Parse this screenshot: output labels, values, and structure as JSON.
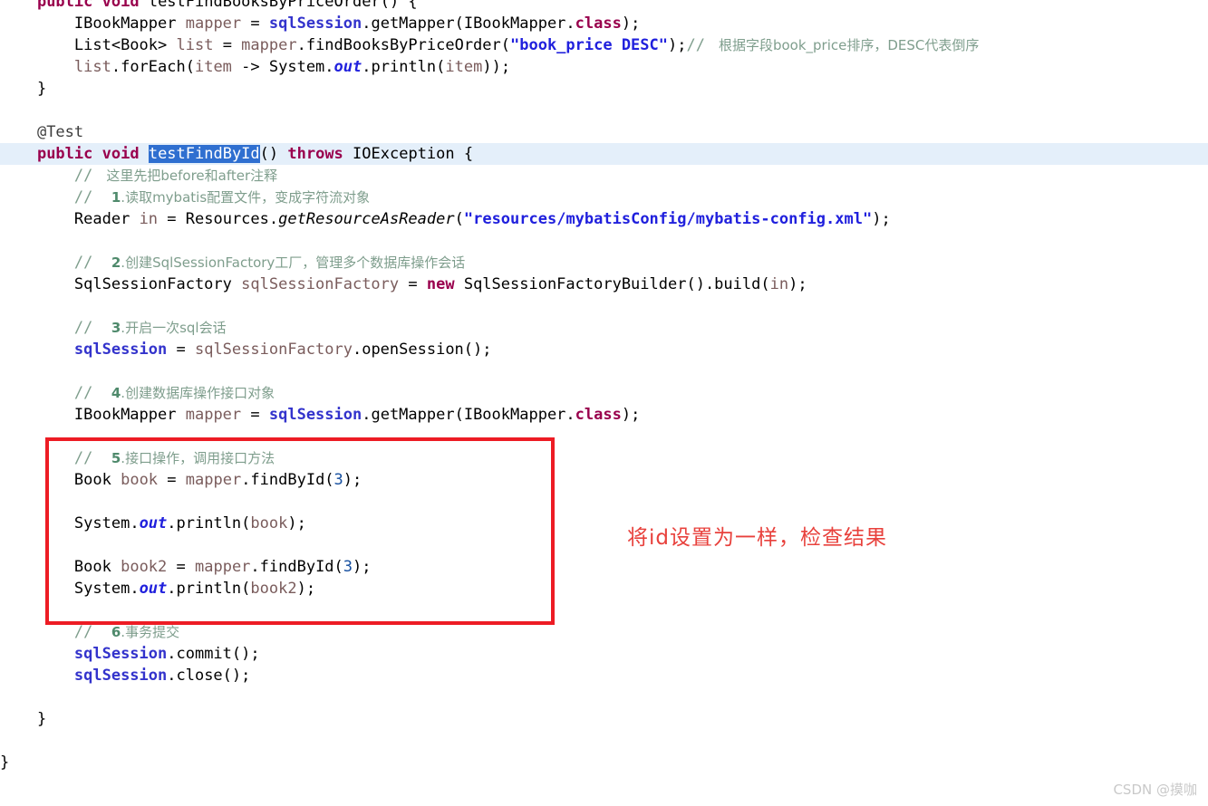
{
  "editor": {
    "language": "Java",
    "background_color": "#ffffff",
    "caret_line_color": "#e4effa",
    "selection_color": "#2f6fd0",
    "annotation_box_color": "#ed1c24",
    "annotation_text_color": "#e8413c"
  },
  "annotation": {
    "note_text": "将id设置为一样，检查结果",
    "box_label": "red-highlight-box"
  },
  "watermark": {
    "text": "CSDN @摸咖"
  },
  "code": {
    "lines": [
      {
        "id": "line-1",
        "tokens": [
          {
            "t": "    ",
            "c": "plain"
          },
          {
            "t": "public",
            "c": "kw"
          },
          {
            "t": " ",
            "c": "plain"
          },
          {
            "t": "void",
            "c": "kw"
          },
          {
            "t": " ",
            "c": "plain"
          },
          {
            "t": "testFindBooksByPriceOrder",
            "c": "meth"
          },
          {
            "t": "() {",
            "c": "plain"
          }
        ]
      },
      {
        "id": "line-2",
        "tokens": [
          {
            "t": "        ",
            "c": "plain"
          },
          {
            "t": "IBookMapper",
            "c": "type"
          },
          {
            "t": " ",
            "c": "plain"
          },
          {
            "t": "mapper",
            "c": "local"
          },
          {
            "t": " = ",
            "c": "plain"
          },
          {
            "t": "sqlSession",
            "c": "field"
          },
          {
            "t": ".getMapper(",
            "c": "plain"
          },
          {
            "t": "IBookMapper",
            "c": "type"
          },
          {
            "t": ".",
            "c": "plain"
          },
          {
            "t": "class",
            "c": "kw"
          },
          {
            "t": ");",
            "c": "plain"
          }
        ]
      },
      {
        "id": "line-3",
        "tokens": [
          {
            "t": "        ",
            "c": "plain"
          },
          {
            "t": "List<Book>",
            "c": "type"
          },
          {
            "t": " ",
            "c": "plain"
          },
          {
            "t": "list",
            "c": "local"
          },
          {
            "t": " = ",
            "c": "plain"
          },
          {
            "t": "mapper",
            "c": "local"
          },
          {
            "t": ".findBooksByPriceOrder(",
            "c": "plain"
          },
          {
            "t": "\"book_price DESC\"",
            "c": "str"
          },
          {
            "t": ");",
            "c": "plain"
          },
          {
            "t": "// ",
            "c": "cmt"
          },
          {
            "t": " 根据字段book_price排序，DESC代表倒序",
            "c": "cmt cjk"
          }
        ]
      },
      {
        "id": "line-4",
        "tokens": [
          {
            "t": "        ",
            "c": "plain"
          },
          {
            "t": "list",
            "c": "local"
          },
          {
            "t": ".forEach(",
            "c": "plain"
          },
          {
            "t": "item",
            "c": "local"
          },
          {
            "t": " -> ",
            "c": "plain"
          },
          {
            "t": "System",
            "c": "plain"
          },
          {
            "t": ".",
            "c": "plain"
          },
          {
            "t": "out",
            "c": "outfld"
          },
          {
            "t": ".println(",
            "c": "plain"
          },
          {
            "t": "item",
            "c": "local"
          },
          {
            "t": "));",
            "c": "plain"
          }
        ]
      },
      {
        "id": "line-5",
        "tokens": [
          {
            "t": "    }",
            "c": "plain"
          }
        ]
      },
      {
        "id": "line-6",
        "tokens": [
          {
            "t": "",
            "c": "plain"
          }
        ]
      },
      {
        "id": "line-7",
        "tokens": [
          {
            "t": "    ",
            "c": "plain"
          },
          {
            "t": "@Test",
            "c": "anno"
          }
        ]
      },
      {
        "id": "line-8",
        "caret": true,
        "tokens": [
          {
            "t": "    ",
            "c": "plain"
          },
          {
            "t": "public",
            "c": "kw"
          },
          {
            "t": " ",
            "c": "plain"
          },
          {
            "t": "void",
            "c": "kw"
          },
          {
            "t": " ",
            "c": "plain"
          },
          {
            "t": "testFindById",
            "c": "sel"
          },
          {
            "t": "() ",
            "c": "plain"
          },
          {
            "t": "throws",
            "c": "kw"
          },
          {
            "t": " ",
            "c": "plain"
          },
          {
            "t": "IOException",
            "c": "type"
          },
          {
            "t": " {",
            "c": "plain"
          }
        ]
      },
      {
        "id": "line-9",
        "tokens": [
          {
            "t": "        ",
            "c": "plain"
          },
          {
            "t": "// ",
            "c": "cmt"
          },
          {
            "t": " 这里先把before和after注释",
            "c": "cmt cjk"
          }
        ]
      },
      {
        "id": "line-10",
        "tokens": [
          {
            "t": "        ",
            "c": "plain"
          },
          {
            "t": "// ",
            "c": "cmt"
          },
          {
            "t": " ",
            "c": "cmt"
          },
          {
            "t": "1",
            "c": "cmt-num cjk"
          },
          {
            "t": ".读取mybatis配置文件，变成字符流对象",
            "c": "cmt cjk"
          }
        ]
      },
      {
        "id": "line-11",
        "tokens": [
          {
            "t": "        ",
            "c": "plain"
          },
          {
            "t": "Reader",
            "c": "type"
          },
          {
            "t": " ",
            "c": "plain"
          },
          {
            "t": "in",
            "c": "local"
          },
          {
            "t": " = ",
            "c": "plain"
          },
          {
            "t": "Resources",
            "c": "plain"
          },
          {
            "t": ".",
            "c": "plain"
          },
          {
            "t": "getResourceAsReader",
            "c": "methit"
          },
          {
            "t": "(",
            "c": "plain"
          },
          {
            "t": "\"resources/mybatisConfig/mybatis-config.xml\"",
            "c": "str"
          },
          {
            "t": ");",
            "c": "plain"
          }
        ]
      },
      {
        "id": "line-12",
        "tokens": [
          {
            "t": "",
            "c": "plain"
          }
        ]
      },
      {
        "id": "line-13",
        "tokens": [
          {
            "t": "        ",
            "c": "plain"
          },
          {
            "t": "// ",
            "c": "cmt"
          },
          {
            "t": " ",
            "c": "cmt"
          },
          {
            "t": "2",
            "c": "cmt-num cjk"
          },
          {
            "t": ".创建SqlSessionFactory工厂，管理多个数据库操作会话",
            "c": "cmt cjk"
          }
        ]
      },
      {
        "id": "line-14",
        "tokens": [
          {
            "t": "        ",
            "c": "plain"
          },
          {
            "t": "SqlSessionFactory",
            "c": "type"
          },
          {
            "t": " ",
            "c": "plain"
          },
          {
            "t": "sqlSessionFactory",
            "c": "local"
          },
          {
            "t": " = ",
            "c": "plain"
          },
          {
            "t": "new",
            "c": "kw"
          },
          {
            "t": " ",
            "c": "plain"
          },
          {
            "t": "SqlSessionFactoryBuilder",
            "c": "plain"
          },
          {
            "t": "().build(",
            "c": "plain"
          },
          {
            "t": "in",
            "c": "local"
          },
          {
            "t": ");",
            "c": "plain"
          }
        ]
      },
      {
        "id": "line-15",
        "tokens": [
          {
            "t": "",
            "c": "plain"
          }
        ]
      },
      {
        "id": "line-16",
        "tokens": [
          {
            "t": "        ",
            "c": "plain"
          },
          {
            "t": "// ",
            "c": "cmt"
          },
          {
            "t": " ",
            "c": "cmt"
          },
          {
            "t": "3",
            "c": "cmt-num cjk"
          },
          {
            "t": ".开启一次sql会话",
            "c": "cmt cjk"
          }
        ]
      },
      {
        "id": "line-17",
        "tokens": [
          {
            "t": "        ",
            "c": "plain"
          },
          {
            "t": "sqlSession",
            "c": "field"
          },
          {
            "t": " = ",
            "c": "plain"
          },
          {
            "t": "sqlSessionFactory",
            "c": "local"
          },
          {
            "t": ".openSession();",
            "c": "plain"
          }
        ]
      },
      {
        "id": "line-18",
        "tokens": [
          {
            "t": "",
            "c": "plain"
          }
        ]
      },
      {
        "id": "line-19",
        "tokens": [
          {
            "t": "        ",
            "c": "plain"
          },
          {
            "t": "// ",
            "c": "cmt"
          },
          {
            "t": " ",
            "c": "cmt"
          },
          {
            "t": "4",
            "c": "cmt-num cjk"
          },
          {
            "t": ".创建数据库操作接口对象",
            "c": "cmt cjk"
          }
        ]
      },
      {
        "id": "line-20",
        "tokens": [
          {
            "t": "        ",
            "c": "plain"
          },
          {
            "t": "IBookMapper",
            "c": "type"
          },
          {
            "t": " ",
            "c": "plain"
          },
          {
            "t": "mapper",
            "c": "local"
          },
          {
            "t": " = ",
            "c": "plain"
          },
          {
            "t": "sqlSession",
            "c": "field"
          },
          {
            "t": ".getMapper(",
            "c": "plain"
          },
          {
            "t": "IBookMapper",
            "c": "type"
          },
          {
            "t": ".",
            "c": "plain"
          },
          {
            "t": "class",
            "c": "kw"
          },
          {
            "t": ");",
            "c": "plain"
          }
        ]
      },
      {
        "id": "line-21",
        "tokens": [
          {
            "t": "",
            "c": "plain"
          }
        ]
      },
      {
        "id": "line-22",
        "tokens": [
          {
            "t": "        ",
            "c": "plain"
          },
          {
            "t": "// ",
            "c": "cmt"
          },
          {
            "t": " ",
            "c": "cmt"
          },
          {
            "t": "5",
            "c": "cmt-num cjk"
          },
          {
            "t": ".接口操作，调用接口方法",
            "c": "cmt cjk"
          }
        ]
      },
      {
        "id": "line-23",
        "tokens": [
          {
            "t": "        ",
            "c": "plain"
          },
          {
            "t": "Book",
            "c": "type"
          },
          {
            "t": " ",
            "c": "plain"
          },
          {
            "t": "book",
            "c": "local"
          },
          {
            "t": " = ",
            "c": "plain"
          },
          {
            "t": "mapper",
            "c": "local"
          },
          {
            "t": ".findById(",
            "c": "plain"
          },
          {
            "t": "3",
            "c": "num"
          },
          {
            "t": ");",
            "c": "plain"
          }
        ]
      },
      {
        "id": "line-24",
        "tokens": [
          {
            "t": "",
            "c": "plain"
          }
        ]
      },
      {
        "id": "line-25",
        "tokens": [
          {
            "t": "        ",
            "c": "plain"
          },
          {
            "t": "System",
            "c": "plain"
          },
          {
            "t": ".",
            "c": "plain"
          },
          {
            "t": "out",
            "c": "outfld"
          },
          {
            "t": ".println(",
            "c": "plain"
          },
          {
            "t": "book",
            "c": "local"
          },
          {
            "t": ");",
            "c": "plain"
          }
        ]
      },
      {
        "id": "line-26",
        "tokens": [
          {
            "t": "",
            "c": "plain"
          }
        ]
      },
      {
        "id": "line-27",
        "tokens": [
          {
            "t": "        ",
            "c": "plain"
          },
          {
            "t": "Book",
            "c": "type"
          },
          {
            "t": " ",
            "c": "plain"
          },
          {
            "t": "book2",
            "c": "local"
          },
          {
            "t": " = ",
            "c": "plain"
          },
          {
            "t": "mapper",
            "c": "local"
          },
          {
            "t": ".findById(",
            "c": "plain"
          },
          {
            "t": "3",
            "c": "num"
          },
          {
            "t": ");",
            "c": "plain"
          }
        ]
      },
      {
        "id": "line-28",
        "tokens": [
          {
            "t": "        ",
            "c": "plain"
          },
          {
            "t": "System",
            "c": "plain"
          },
          {
            "t": ".",
            "c": "plain"
          },
          {
            "t": "out",
            "c": "outfld"
          },
          {
            "t": ".println(",
            "c": "plain"
          },
          {
            "t": "book2",
            "c": "local"
          },
          {
            "t": ");",
            "c": "plain"
          }
        ]
      },
      {
        "id": "line-29",
        "tokens": [
          {
            "t": "",
            "c": "plain"
          }
        ]
      },
      {
        "id": "line-30",
        "tokens": [
          {
            "t": "        ",
            "c": "plain"
          },
          {
            "t": "// ",
            "c": "cmt"
          },
          {
            "t": " ",
            "c": "cmt"
          },
          {
            "t": "6",
            "c": "cmt-num cjk"
          },
          {
            "t": ".事务提交",
            "c": "cmt cjk"
          }
        ]
      },
      {
        "id": "line-31",
        "tokens": [
          {
            "t": "        ",
            "c": "plain"
          },
          {
            "t": "sqlSession",
            "c": "field"
          },
          {
            "t": ".commit();",
            "c": "plain"
          }
        ]
      },
      {
        "id": "line-32",
        "tokens": [
          {
            "t": "        ",
            "c": "plain"
          },
          {
            "t": "sqlSession",
            "c": "field"
          },
          {
            "t": ".close();",
            "c": "plain"
          }
        ]
      },
      {
        "id": "line-33",
        "tokens": [
          {
            "t": "",
            "c": "plain"
          }
        ]
      },
      {
        "id": "line-34",
        "tokens": [
          {
            "t": "    }",
            "c": "plain"
          }
        ]
      },
      {
        "id": "line-35",
        "tokens": [
          {
            "t": "",
            "c": "plain"
          }
        ]
      },
      {
        "id": "line-36",
        "tokens": [
          {
            "t": "}",
            "c": "plain"
          }
        ]
      }
    ]
  }
}
